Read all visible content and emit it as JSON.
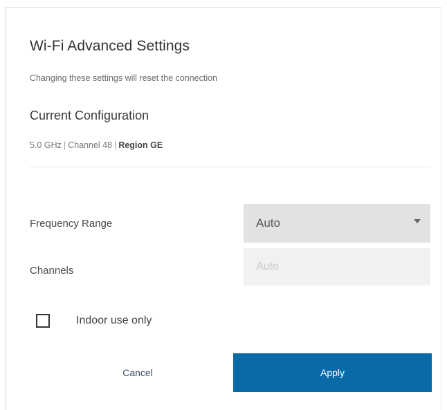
{
  "dialog": {
    "title": "Wi-Fi Advanced Settings",
    "subtitle": "Changing these settings will reset the connection"
  },
  "current_config": {
    "heading": "Current Configuration",
    "band": "5.0 GHz",
    "separator": "|",
    "channel": "Channel 48",
    "region": "Region GE"
  },
  "form": {
    "frequency_label": "Frequency Range",
    "frequency_value": "Auto",
    "channels_label": "Channels",
    "channels_placeholder": "Auto",
    "indoor_label": "Indoor use only",
    "indoor_checked": false
  },
  "actions": {
    "cancel_label": "Cancel",
    "apply_label": "Apply"
  },
  "colors": {
    "apply_button": "#0a6aa8",
    "select_background": "#e2e2e2",
    "disabled_input_background": "#f1f1f1"
  }
}
